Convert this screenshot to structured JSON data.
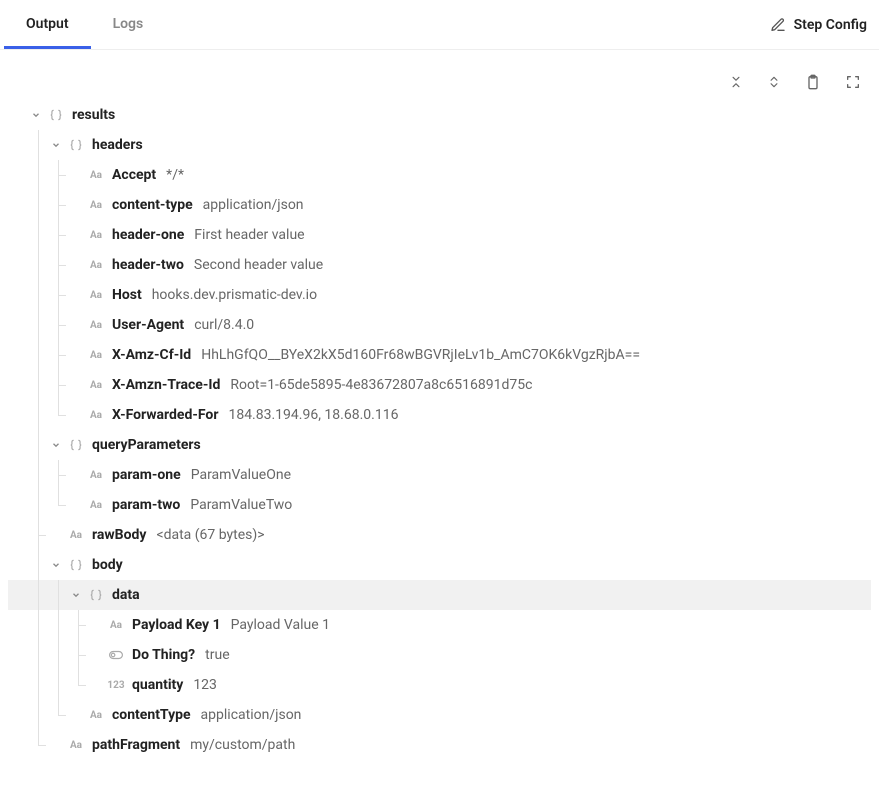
{
  "tabs": {
    "output": "Output",
    "logs": "Logs"
  },
  "stepConfig": "Step Config",
  "tree": {
    "results": "results",
    "headers": {
      "label": "headers",
      "items": [
        {
          "k": "Accept",
          "v": "*/*"
        },
        {
          "k": "content-type",
          "v": "application/json"
        },
        {
          "k": "header-one",
          "v": "First header value"
        },
        {
          "k": "header-two",
          "v": "Second header value"
        },
        {
          "k": "Host",
          "v": "hooks.dev.prismatic-dev.io"
        },
        {
          "k": "User-Agent",
          "v": "curl/8.4.0"
        },
        {
          "k": "X-Amz-Cf-Id",
          "v": "HhLhGfQO__BYeX2kX5d160Fr68wBGVRjIeLv1b_AmC7OK6kVgzRjbA=="
        },
        {
          "k": "X-Amzn-Trace-Id",
          "v": "Root=1-65de5895-4e83672807a8c6516891d75c"
        },
        {
          "k": "X-Forwarded-For",
          "v": "184.83.194.96, 18.68.0.116"
        }
      ]
    },
    "queryParameters": {
      "label": "queryParameters",
      "items": [
        {
          "k": "param-one",
          "v": "ParamValueOne"
        },
        {
          "k": "param-two",
          "v": "ParamValueTwo"
        }
      ]
    },
    "rawBody": {
      "k": "rawBody",
      "v": "<data (67 bytes)>"
    },
    "body": {
      "label": "body",
      "data": {
        "label": "data",
        "items": [
          {
            "k": "Payload Key 1",
            "v": "Payload Value 1",
            "t": "str"
          },
          {
            "k": "Do Thing?",
            "v": "true",
            "t": "bool"
          },
          {
            "k": "quantity",
            "v": "123",
            "t": "num"
          }
        ]
      },
      "contentType": {
        "k": "contentType",
        "v": "application/json"
      }
    },
    "pathFragment": {
      "k": "pathFragment",
      "v": "my/custom/path"
    }
  }
}
